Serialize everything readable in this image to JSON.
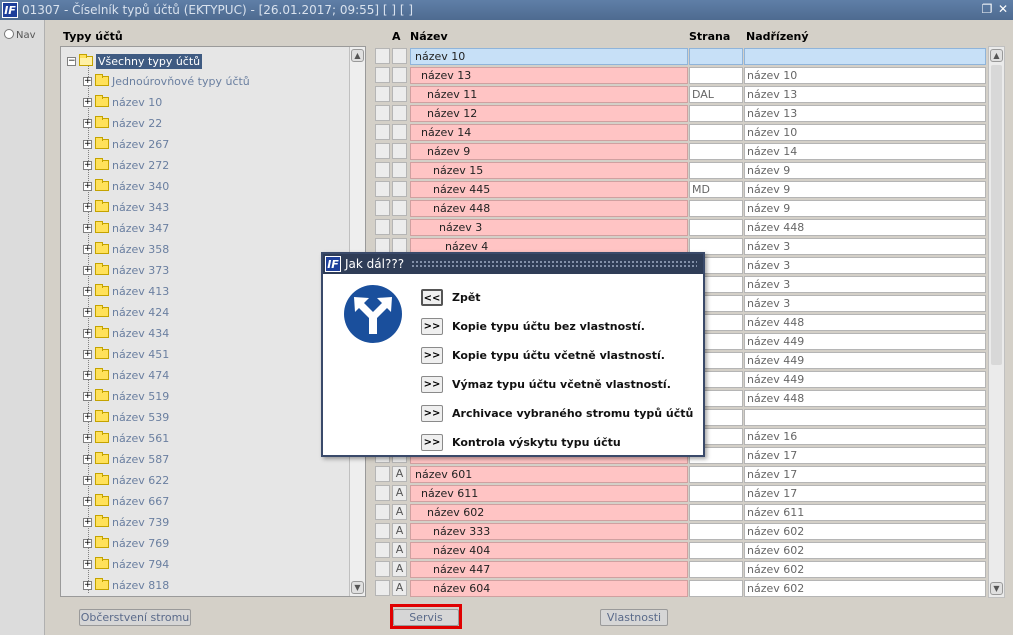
{
  "window": {
    "title": "01307 - Číselník typů účtů (EKTYPUC) - [26.01.2017; 09:55]  [ ]  [ ]",
    "app_icon": "IF",
    "restore_icon": "restore-icon",
    "close_icon": "close-icon"
  },
  "nav": {
    "label": "Nav"
  },
  "tree": {
    "label": "Typy účtů",
    "root": "Všechny typy účtů",
    "items": [
      "Jednoúrovňové typy účtů",
      "název 10",
      "název 22",
      "název 267",
      "název 272",
      "název 340",
      "název 343",
      "název 347",
      "název 358",
      "název 373",
      "název 413",
      "název 424",
      "název 434",
      "název 451",
      "název 474",
      "název 519",
      "název 539",
      "název 561",
      "název 587",
      "název 622",
      "název 667",
      "název 739",
      "název 769",
      "název 794",
      "název 818"
    ]
  },
  "grid": {
    "headers": {
      "a": "A",
      "nazev": "Název",
      "strana": "Strana",
      "nadrizeny": "Nadřízený"
    },
    "rows": [
      {
        "a": "",
        "nazev": "název 10",
        "indent": 0,
        "strana": "",
        "nadrizeny": ""
      },
      {
        "a": "",
        "nazev": "název 13",
        "indent": 1,
        "strana": "",
        "nadrizeny": "název 10"
      },
      {
        "a": "",
        "nazev": "název 11",
        "indent": 2,
        "strana": "DAL",
        "nadrizeny": "název 13"
      },
      {
        "a": "",
        "nazev": "název 12",
        "indent": 2,
        "strana": "",
        "nadrizeny": "název 13"
      },
      {
        "a": "",
        "nazev": "název 14",
        "indent": 1,
        "strana": "",
        "nadrizeny": "název 10"
      },
      {
        "a": "",
        "nazev": "název 9",
        "indent": 2,
        "strana": "",
        "nadrizeny": "název 14"
      },
      {
        "a": "",
        "nazev": "název 15",
        "indent": 3,
        "strana": "",
        "nadrizeny": "název 9"
      },
      {
        "a": "",
        "nazev": "název 445",
        "indent": 3,
        "strana": "MD",
        "nadrizeny": "název 9"
      },
      {
        "a": "",
        "nazev": "název 448",
        "indent": 3,
        "strana": "",
        "nadrizeny": "název 9"
      },
      {
        "a": "",
        "nazev": "název 3",
        "indent": 4,
        "strana": "",
        "nadrizeny": "název 448"
      },
      {
        "a": "",
        "nazev": "název 4",
        "indent": 5,
        "strana": "",
        "nadrizeny": "název 3"
      },
      {
        "a": "",
        "nazev": "",
        "indent": 0,
        "strana": "",
        "nadrizeny": "název 3"
      },
      {
        "a": "",
        "nazev": "",
        "indent": 0,
        "strana": "",
        "nadrizeny": "název 3"
      },
      {
        "a": "",
        "nazev": "",
        "indent": 0,
        "strana": "",
        "nadrizeny": "název 3"
      },
      {
        "a": "",
        "nazev": "",
        "indent": 0,
        "strana": "",
        "nadrizeny": "název 448"
      },
      {
        "a": "",
        "nazev": "",
        "indent": 0,
        "strana": "",
        "nadrizeny": "název 449"
      },
      {
        "a": "",
        "nazev": "",
        "indent": 0,
        "strana": "",
        "nadrizeny": "název 449"
      },
      {
        "a": "",
        "nazev": "",
        "indent": 0,
        "strana": "",
        "nadrizeny": "název 449"
      },
      {
        "a": "",
        "nazev": "",
        "indent": 0,
        "strana": "",
        "nadrizeny": "název 448"
      },
      {
        "a": "",
        "nazev": "",
        "indent": 0,
        "strana": "",
        "nadrizeny": ""
      },
      {
        "a": "",
        "nazev": "",
        "indent": 0,
        "strana": "",
        "nadrizeny": "název 16"
      },
      {
        "a": "",
        "nazev": "",
        "indent": 0,
        "strana": "",
        "nadrizeny": "název 17"
      },
      {
        "a": "A",
        "nazev": "název 601",
        "indent": 0,
        "strana": "",
        "nadrizeny": "název 17"
      },
      {
        "a": "A",
        "nazev": "název 611",
        "indent": 1,
        "strana": "",
        "nadrizeny": "název 17"
      },
      {
        "a": "A",
        "nazev": "název 602",
        "indent": 2,
        "strana": "",
        "nadrizeny": "název 611"
      },
      {
        "a": "A",
        "nazev": "název 333",
        "indent": 3,
        "strana": "",
        "nadrizeny": "název 602"
      },
      {
        "a": "A",
        "nazev": "název 404",
        "indent": 3,
        "strana": "",
        "nadrizeny": "název 602"
      },
      {
        "a": "A",
        "nazev": "název 447",
        "indent": 3,
        "strana": "",
        "nadrizeny": "název 602"
      },
      {
        "a": "A",
        "nazev": "název 604",
        "indent": 3,
        "strana": "",
        "nadrizeny": "název 602"
      }
    ]
  },
  "buttons": {
    "refresh": "Občerstvení stromu",
    "servis": "Servis",
    "properties": "Vlastnosti"
  },
  "dialog": {
    "title": "Jak dál???",
    "sign_icon": "fork-arrow-icon",
    "options": [
      {
        "btn": "<<",
        "label": "Zpět"
      },
      {
        "btn": ">>",
        "label": "Kopie typu účtu bez vlastností."
      },
      {
        "btn": ">>",
        "label": "Kopie typu účtu včetně vlastností."
      },
      {
        "btn": ">>",
        "label": "Výmaz typu účtu včetně vlastností."
      },
      {
        "btn": ">>",
        "label": "Archivace vybraného stromu typů účtů"
      },
      {
        "btn": ">>",
        "label": "Kontrola výskytu typu účtu"
      }
    ]
  },
  "colors": {
    "name_cell": "#ffc4c4",
    "selected_row": "#c7e0f7",
    "highlight_border": "#e00000",
    "dialog_title": "#2f3d57"
  }
}
